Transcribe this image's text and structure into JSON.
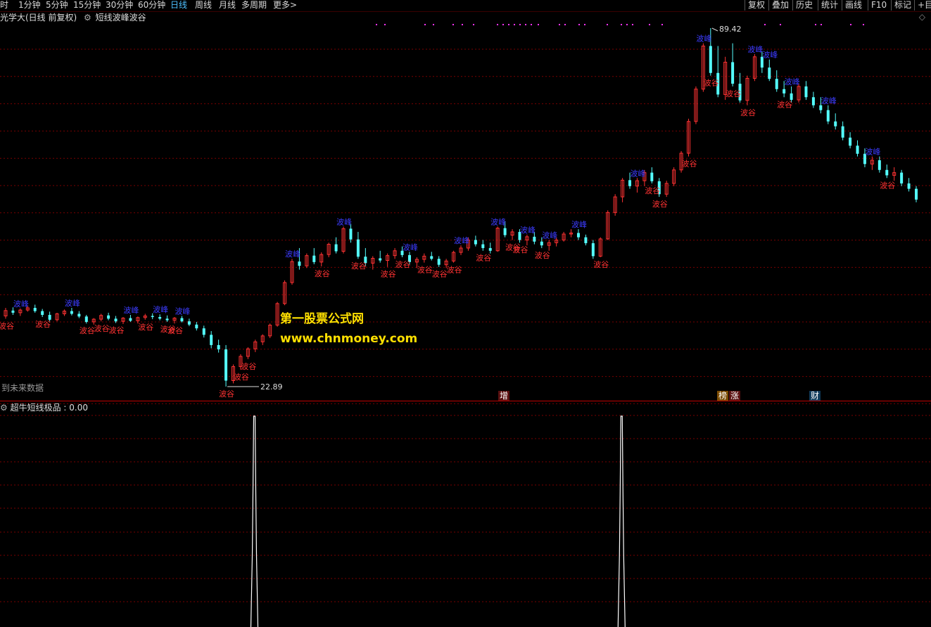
{
  "toolbar": {
    "periods": [
      "时",
      "1分钟",
      "5分钟",
      "15分钟",
      "30分钟",
      "60分钟",
      "日线",
      "周线",
      "月线",
      "多周期",
      "更多>"
    ],
    "active_period": "日线",
    "buttons": [
      "复权",
      "叠加",
      "历史",
      "统计",
      "画线",
      "F10",
      "标记",
      "+目"
    ]
  },
  "main_panel": {
    "stock_title": "光学大(日线 前复权)",
    "indicator_name": "短线波峰波谷",
    "high_label": "89.42",
    "low_label": "22.89",
    "no_future_label": "到未来数据",
    "peak_label": "波峰",
    "trough_label": "波谷"
  },
  "watermark": {
    "line1": "第一股票公式网",
    "line2": "www.chnmoney.com"
  },
  "event_tags": [
    {
      "label": "增",
      "color": "#ffffff",
      "bg": "#5a1010"
    },
    {
      "label": "榜",
      "color": "#ffffff",
      "bg": "#7a4a00"
    },
    {
      "label": "涨",
      "color": "#ffffff",
      "bg": "#5a1010"
    },
    {
      "label": "财",
      "color": "#ffffff",
      "bg": "#103a5a"
    }
  ],
  "sub_panel": {
    "title": "超牛短线极品 : 0.00"
  },
  "colors": {
    "up": "#ff3232",
    "down": "#54ffff",
    "peak_text": "#3c3cff",
    "trough_text": "#ff3232",
    "grid": "#7a0000",
    "signal_line": "#ffffff",
    "dots": "#ff33ff"
  },
  "chart_data": {
    "type": "candlestick",
    "price_range": [
      22.89,
      89.42
    ],
    "candles": [
      [
        36.0,
        37.5,
        35.5,
        37.0
      ],
      [
        37.0,
        37.6,
        36.2,
        36.6
      ],
      [
        36.6,
        37.4,
        36.0,
        37.1
      ],
      [
        37.1,
        37.9,
        36.8,
        37.5
      ],
      [
        37.5,
        38.1,
        36.6,
        36.9
      ],
      [
        36.9,
        37.3,
        35.8,
        36.2
      ],
      [
        36.2,
        36.8,
        35.0,
        35.3
      ],
      [
        35.3,
        36.6,
        35.0,
        36.4
      ],
      [
        36.4,
        37.2,
        36.0,
        36.9
      ],
      [
        36.9,
        37.5,
        36.1,
        36.4
      ],
      [
        36.4,
        36.9,
        35.6,
        35.9
      ],
      [
        35.9,
        36.2,
        34.6,
        34.9
      ],
      [
        34.9,
        35.6,
        34.4,
        35.4
      ],
      [
        35.4,
        36.4,
        35.0,
        36.1
      ],
      [
        36.1,
        36.6,
        35.2,
        35.5
      ],
      [
        35.5,
        36.0,
        34.7,
        35.0
      ],
      [
        35.0,
        35.8,
        34.5,
        35.6
      ],
      [
        35.6,
        36.2,
        34.9,
        35.1
      ],
      [
        35.1,
        35.9,
        34.6,
        35.7
      ],
      [
        35.7,
        36.4,
        35.3,
        36.0
      ],
      [
        36.0,
        36.5,
        35.4,
        35.8
      ],
      [
        35.8,
        36.3,
        35.2,
        35.5
      ],
      [
        35.5,
        36.1,
        34.9,
        35.2
      ],
      [
        35.2,
        35.8,
        34.6,
        35.6
      ],
      [
        35.6,
        36.0,
        34.8,
        35.0
      ],
      [
        35.0,
        35.5,
        34.1,
        34.4
      ],
      [
        34.4,
        34.9,
        33.3,
        33.7
      ],
      [
        33.7,
        34.2,
        32.0,
        32.5
      ],
      [
        32.5,
        33.2,
        30.0,
        30.6
      ],
      [
        30.6,
        31.6,
        29.2,
        29.8
      ],
      [
        29.8,
        30.6,
        22.89,
        24.0
      ],
      [
        24.0,
        27.0,
        23.5,
        26.6
      ],
      [
        26.6,
        28.9,
        26.0,
        28.5
      ],
      [
        28.5,
        30.2,
        28.0,
        29.9
      ],
      [
        29.9,
        31.6,
        29.3,
        31.2
      ],
      [
        31.2,
        32.6,
        30.6,
        32.3
      ],
      [
        32.3,
        34.6,
        31.9,
        34.3
      ],
      [
        34.3,
        38.6,
        34.0,
        38.3
      ],
      [
        38.3,
        42.6,
        38.0,
        42.2
      ],
      [
        42.2,
        46.6,
        41.8,
        46.1
      ],
      [
        46.1,
        48.6,
        44.6,
        45.3
      ],
      [
        45.3,
        47.6,
        44.9,
        47.2
      ],
      [
        47.2,
        48.6,
        45.6,
        46.0
      ],
      [
        46.0,
        47.8,
        45.2,
        47.4
      ],
      [
        47.4,
        49.6,
        46.9,
        49.3
      ],
      [
        49.3,
        50.6,
        47.6,
        48.0
      ],
      [
        48.0,
        52.6,
        47.6,
        52.2
      ],
      [
        52.2,
        53.1,
        49.6,
        50.2
      ],
      [
        50.2,
        51.6,
        46.6,
        47.0
      ],
      [
        47.0,
        48.6,
        45.3,
        45.8
      ],
      [
        45.8,
        47.1,
        44.6,
        46.7
      ],
      [
        46.7,
        48.1,
        45.9,
        46.3
      ],
      [
        46.3,
        47.6,
        45.1,
        47.2
      ],
      [
        47.2,
        48.6,
        46.6,
        48.1
      ],
      [
        48.1,
        48.9,
        46.9,
        47.3
      ],
      [
        47.3,
        47.9,
        45.6,
        46.0
      ],
      [
        46.0,
        46.9,
        44.9,
        46.5
      ],
      [
        46.5,
        47.6,
        45.9,
        47.1
      ],
      [
        47.1,
        47.9,
        46.3,
        46.6
      ],
      [
        46.6,
        47.1,
        45.1,
        45.5
      ],
      [
        45.5,
        46.6,
        44.9,
        46.2
      ],
      [
        46.2,
        48.1,
        45.9,
        47.8
      ],
      [
        47.8,
        49.1,
        47.3,
        48.6
      ],
      [
        48.6,
        50.6,
        48.1,
        50.1
      ],
      [
        50.1,
        50.9,
        48.9,
        49.3
      ],
      [
        49.3,
        50.1,
        48.1,
        48.6
      ],
      [
        48.6,
        49.6,
        47.6,
        48.1
      ],
      [
        48.1,
        52.6,
        47.9,
        52.3
      ],
      [
        52.3,
        53.6,
        50.6,
        51.0
      ],
      [
        51.0,
        52.1,
        50.1,
        51.6
      ],
      [
        51.6,
        52.1,
        49.6,
        50.1
      ],
      [
        50.1,
        51.1,
        49.1,
        50.7
      ],
      [
        50.7,
        51.6,
        49.3,
        49.8
      ],
      [
        49.8,
        50.6,
        48.6,
        49.1
      ],
      [
        49.1,
        50.1,
        48.1,
        49.6
      ],
      [
        49.6,
        50.6,
        48.9,
        50.1
      ],
      [
        50.1,
        51.6,
        49.8,
        51.2
      ],
      [
        51.2,
        52.1,
        50.6,
        51.4
      ],
      [
        51.4,
        52.1,
        50.1,
        50.6
      ],
      [
        50.6,
        51.1,
        49.1,
        49.5
      ],
      [
        49.5,
        50.1,
        46.6,
        47.1
      ],
      [
        47.1,
        50.6,
        46.9,
        50.3
      ],
      [
        50.3,
        55.6,
        50.1,
        55.2
      ],
      [
        55.2,
        58.6,
        54.6,
        58.1
      ],
      [
        58.1,
        61.6,
        57.1,
        61.2
      ],
      [
        61.2,
        62.6,
        59.6,
        60.1
      ],
      [
        60.1,
        61.6,
        58.9,
        61.1
      ],
      [
        61.1,
        63.1,
        60.1,
        62.6
      ],
      [
        62.6,
        63.6,
        60.6,
        61.0
      ],
      [
        61.0,
        61.6,
        58.1,
        58.6
      ],
      [
        58.6,
        61.1,
        58.1,
        60.6
      ],
      [
        60.6,
        63.6,
        60.1,
        63.1
      ],
      [
        63.1,
        66.6,
        62.6,
        66.2
      ],
      [
        66.2,
        72.6,
        65.6,
        72.1
      ],
      [
        72.1,
        78.6,
        71.6,
        78.1
      ],
      [
        78.1,
        86.6,
        77.6,
        86.1
      ],
      [
        86.1,
        89.42,
        80.6,
        81.1
      ],
      [
        81.1,
        86.1,
        76.6,
        77.1
      ],
      [
        77.1,
        84.1,
        76.1,
        83.1
      ],
      [
        83.1,
        86.6,
        78.6,
        79.1
      ],
      [
        79.1,
        81.1,
        75.6,
        76.0
      ],
      [
        76.0,
        80.6,
        75.1,
        80.1
      ],
      [
        80.1,
        84.6,
        79.6,
        84.1
      ],
      [
        84.1,
        85.1,
        81.1,
        82.1
      ],
      [
        82.1,
        83.6,
        79.6,
        80.0
      ],
      [
        80.0,
        81.6,
        77.6,
        78.1
      ],
      [
        78.1,
        79.6,
        76.6,
        77.3
      ],
      [
        77.3,
        78.6,
        75.6,
        76.1
      ],
      [
        76.1,
        79.1,
        75.6,
        78.6
      ],
      [
        78.6,
        79.6,
        76.1,
        76.6
      ],
      [
        76.6,
        77.6,
        74.6,
        75.1
      ],
      [
        75.1,
        76.6,
        73.6,
        74.2
      ],
      [
        74.2,
        75.1,
        71.6,
        72.1
      ],
      [
        72.1,
        73.6,
        70.6,
        71.2
      ],
      [
        71.2,
        72.1,
        68.6,
        69.1
      ],
      [
        69.1,
        70.1,
        67.1,
        67.6
      ],
      [
        67.6,
        68.6,
        65.6,
        66.1
      ],
      [
        66.1,
        67.1,
        63.6,
        64.2
      ],
      [
        64.2,
        65.6,
        63.1,
        64.9
      ],
      [
        64.9,
        65.6,
        62.6,
        63.1
      ],
      [
        63.1,
        64.1,
        61.6,
        62.1
      ],
      [
        62.1,
        63.6,
        61.1,
        62.6
      ],
      [
        62.6,
        63.1,
        60.1,
        60.6
      ],
      [
        60.6,
        61.6,
        59.1,
        59.6
      ],
      [
        59.6,
        60.1,
        57.1,
        57.6
      ]
    ],
    "peaks": [
      2,
      9,
      17,
      21,
      24,
      39,
      46,
      55,
      62,
      67,
      71,
      74,
      78,
      86,
      95,
      102,
      104,
      107,
      112,
      118
    ],
    "troughs": [
      0,
      5,
      11,
      13,
      15,
      19,
      22,
      23,
      30,
      32,
      33,
      43,
      48,
      52,
      54,
      57,
      59,
      61,
      65,
      69,
      70,
      73,
      81,
      88,
      89,
      93,
      96,
      99,
      101,
      106,
      120
    ],
    "signals": [
      31,
      81
    ],
    "sub_panel_value": 0.0
  }
}
